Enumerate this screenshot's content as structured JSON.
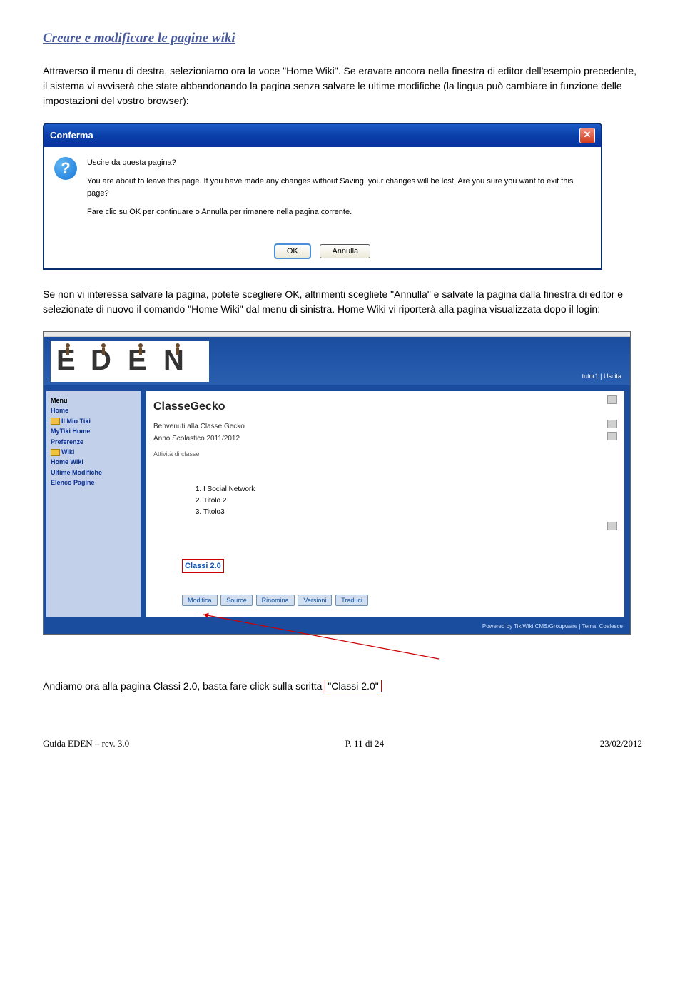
{
  "doc": {
    "title": "Creare e modificare le pagine wiki",
    "para1": "Attraverso il menu di destra, selezioniamo ora la voce \"Home Wiki\". Se eravate ancora nella finestra di editor dell'esempio precedente, il sistema vi avviserà che state abbandonando la pagina senza salvare le ultime modifiche (la lingua può cambiare in funzione delle impostazioni del vostro browser):",
    "para2": "Se non vi interessa salvare la pagina, potete scegliere OK, altrimenti scegliete \"Annulla\" e salvate la pagina dalla finestra di editor e selezionate di nuovo il comando \"Home Wiki\" dal menu di sinistra. Home Wiki vi riporterà alla pagina visualizzata dopo il login:",
    "para3_prefix": "Andiamo ora alla pagina Classi 2.0, basta fare click sulla scritta ",
    "para3_box": "\"Classi 2.0\""
  },
  "dialog": {
    "title": "Conferma",
    "line1": "Uscire da questa pagina?",
    "line2": "You are about to leave this page. If you have made any changes without Saving, your changes will be lost.  Are you sure you want to exit this page?",
    "line3": "Fare clic su OK per continuare o Annulla per rimanere nella pagina corrente.",
    "ok": "OK",
    "cancel": "Annulla"
  },
  "eden": {
    "userlinks": "tutor1 | Uscita",
    "menu_heading": "Menu",
    "menu": {
      "home": "Home",
      "miotiki": "Il Mio Tiki",
      "mytikihome": "MyTiki Home",
      "preferenze": "Preferenze",
      "wiki": "Wiki",
      "homewiki": "Home Wiki",
      "ultime": "Ultime Modifiche",
      "elenco": "Elenco Pagine"
    },
    "main": {
      "title": "ClasseGecko",
      "welcome": "Benvenuti alla Classe Gecko",
      "year": "Anno Scolastico 2011/2012",
      "activity": "Attività di classe",
      "item1": "I Social Network",
      "item2": "Titolo 2",
      "item3": "Titolo3",
      "classi": "Classi 2.0",
      "buttons": {
        "modifica": "Modifica",
        "source": "Source",
        "rinomina": "Rinomina",
        "versioni": "Versioni",
        "traduci": "Traduci"
      }
    },
    "footer": {
      "prefix": "Powered by ",
      "link": "TikiWiki CMS/Groupware",
      "suffix": " | Tema: Coalesce"
    }
  },
  "docfooter": {
    "left": "Guida EDEN – rev. 3.0",
    "center": "P. 11 di 24",
    "right": "23/02/2012"
  }
}
